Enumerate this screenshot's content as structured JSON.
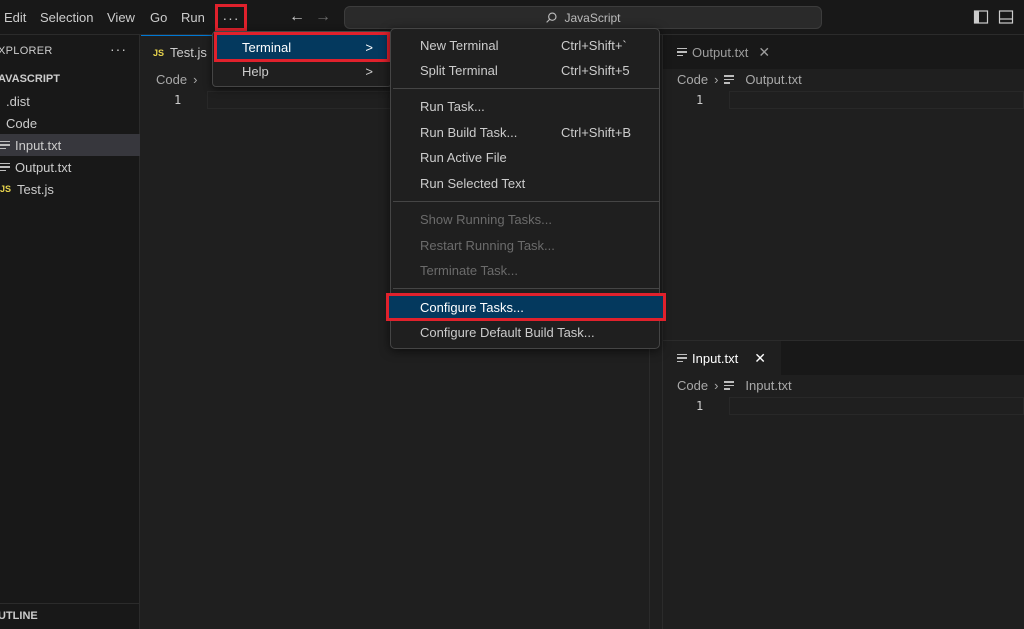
{
  "menubar": {
    "items": [
      "Edit",
      "Selection",
      "View",
      "Go",
      "Run"
    ],
    "more_icon": "ellipsis-icon",
    "search_text": "JavaScript"
  },
  "sidebar": {
    "title": "XPLORER",
    "root": "AVASCRIPT",
    "items": [
      {
        "label": ".dist",
        "type": "folder"
      },
      {
        "label": "Code",
        "type": "folder"
      },
      {
        "label": "Input.txt",
        "type": "txt",
        "selected": true
      },
      {
        "label": "Output.txt",
        "type": "txt"
      },
      {
        "label": "Test.js",
        "type": "js"
      }
    ],
    "outline": "UTLINE"
  },
  "editor_left": {
    "tab_badge": "JS",
    "tab_label": "Test.js",
    "crumb_root": "Code",
    "line": "1"
  },
  "editor_right_top": {
    "tab_label": "Output.txt",
    "close": "✕",
    "crumb_root": "Code",
    "crumb_file": "Output.txt",
    "line": "1"
  },
  "editor_right_bottom": {
    "tab_label": "Input.txt",
    "close": "✕",
    "crumb_root": "Code",
    "crumb_file": "Input.txt",
    "line": "1"
  },
  "menu_level1": [
    {
      "label": "Terminal",
      "highlighted": true
    },
    {
      "label": "Help"
    }
  ],
  "terminal_menu": {
    "groups": [
      [
        {
          "label": "New Terminal",
          "shortcut": "Ctrl+Shift+`"
        },
        {
          "label": "Split Terminal",
          "shortcut": "Ctrl+Shift+5"
        }
      ],
      [
        {
          "label": "Run Task...",
          "shortcut": ""
        },
        {
          "label": "Run Build Task...",
          "shortcut": "Ctrl+Shift+B"
        },
        {
          "label": "Run Active File",
          "shortcut": ""
        },
        {
          "label": "Run Selected Text",
          "shortcut": ""
        }
      ],
      [
        {
          "label": "Show Running Tasks...",
          "disabled": true
        },
        {
          "label": "Restart Running Task...",
          "disabled": true
        },
        {
          "label": "Terminate Task...",
          "disabled": true
        }
      ],
      [
        {
          "label": "Configure Tasks...",
          "highlighted": true
        },
        {
          "label": "Configure Default Build Task..."
        }
      ]
    ]
  },
  "colors": {
    "highlight_bg": "#04395e",
    "annotation_red": "#e0212c",
    "js_yellow": "#e8d44d"
  }
}
